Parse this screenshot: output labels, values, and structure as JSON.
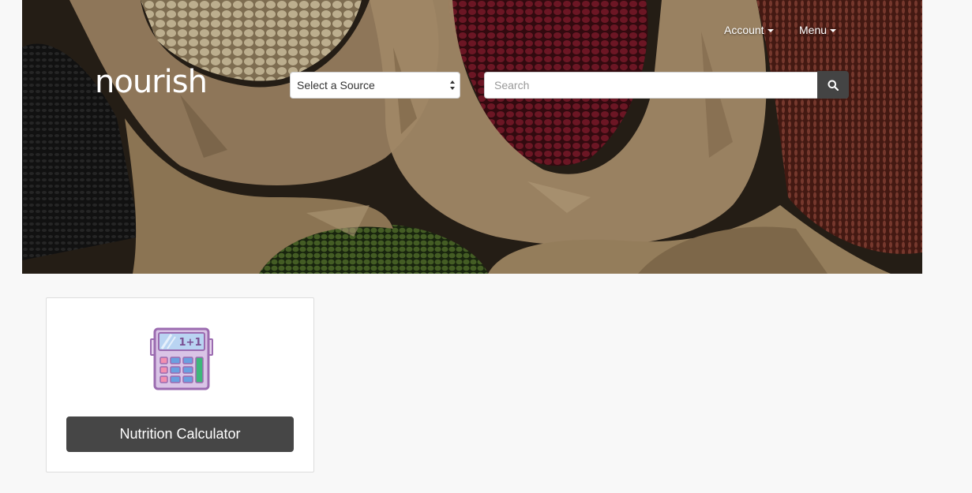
{
  "header": {
    "logo_text": "nourish",
    "nav": {
      "account_label": "Account",
      "menu_label": "Menu"
    },
    "source_select": {
      "selected": "Select a Source"
    },
    "search": {
      "placeholder": "Search"
    }
  },
  "main": {
    "cards": [
      {
        "icon": "calculator-icon",
        "icon_text": "1+1",
        "button_label": "Nutrition Calculator"
      }
    ]
  },
  "colors": {
    "page_bg": "#f8f8f8",
    "button_dark": "#464646",
    "search_button": "#444444",
    "calc_purple": "#9b6bb0",
    "calc_blue": "#6aa0e0",
    "calc_pink": "#f28fb0",
    "calc_green": "#3db87a"
  }
}
